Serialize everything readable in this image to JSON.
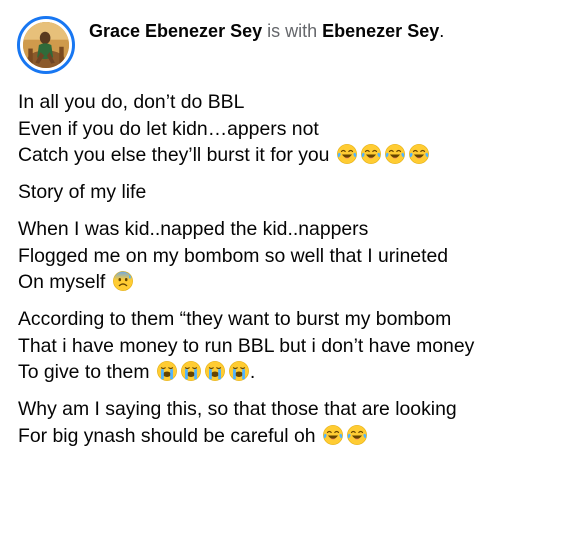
{
  "post": {
    "author": "Grace Ebenezer Sey",
    "with_text": "is with",
    "tagged": "Ebenezer Sey",
    "tagged_suffix": ".",
    "paragraphs": [
      {
        "lines": [
          {
            "text": "In all you do, don’t do BBL",
            "emojis": []
          },
          {
            "text": "Even if you do let kidn…appers not",
            "emojis": []
          },
          {
            "text": "Catch you else they’ll burst it for you ",
            "emojis": [
              "face-with-tears-of-joy",
              "face-with-tears-of-joy",
              "face-with-tears-of-joy",
              "face-with-tears-of-joy"
            ]
          }
        ]
      },
      {
        "lines": [
          {
            "text": "Story of my life",
            "emojis": []
          }
        ]
      },
      {
        "lines": [
          {
            "text": "When I was kid..napped  the kid..nappers",
            "emojis": []
          },
          {
            "text": "Flogged me on my bombom so well that I  urineted",
            "emojis": []
          },
          {
            "text": "On myself ",
            "emojis": [
              "anxious-face-with-sweat"
            ]
          }
        ]
      },
      {
        "lines": [
          {
            "text": "According to them “they want to burst my bombom",
            "emojis": []
          },
          {
            "text": "That i have money to run BBL but i don’t have money",
            "emojis": []
          },
          {
            "text": "To give to them ",
            "emojis": [
              "loudly-crying-face",
              "loudly-crying-face",
              "loudly-crying-face",
              "loudly-crying-face"
            ],
            "after": "."
          }
        ]
      },
      {
        "lines": [
          {
            "text": "Why am I saying this, so that those that are looking",
            "emojis": []
          },
          {
            "text": "For big ynash should be careful oh ",
            "emojis": [
              "face-with-tears-of-joy",
              "face-with-tears-of-joy"
            ]
          }
        ]
      }
    ]
  },
  "colors": {
    "avatar_ring": "#1877f2",
    "name_text": "#050505",
    "with_text": "#65676b"
  }
}
